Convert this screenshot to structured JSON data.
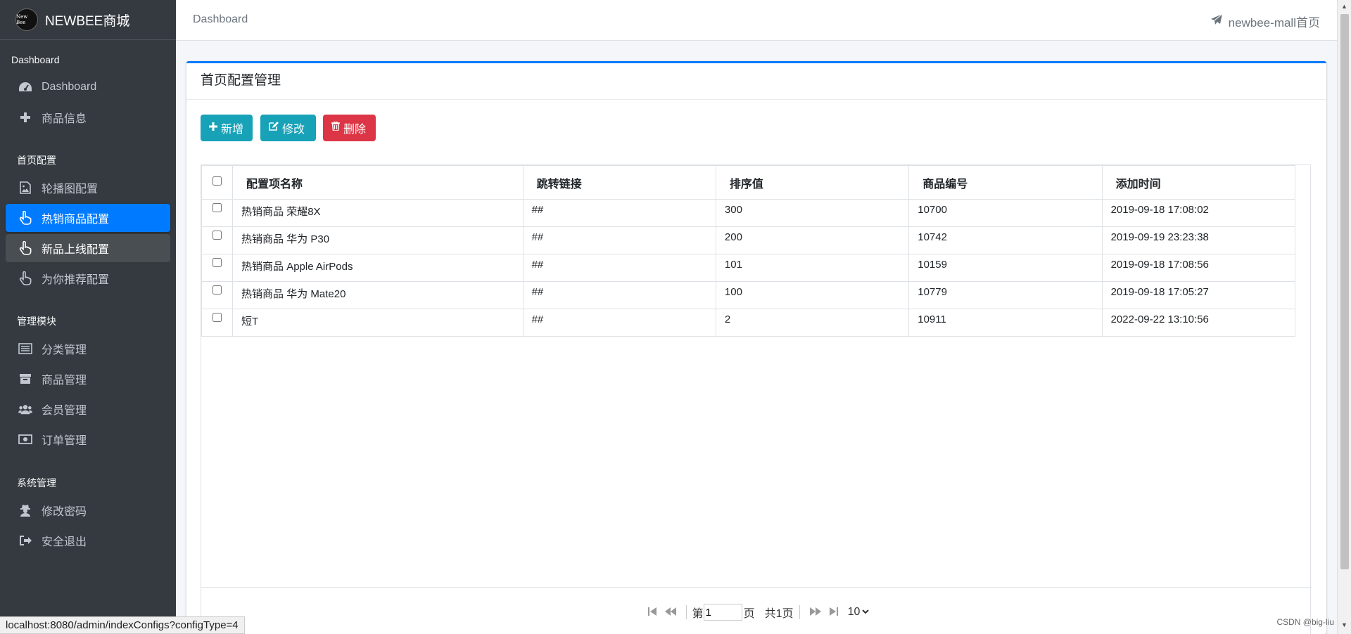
{
  "brand": {
    "logo_text": "New Bee",
    "name": "NEWBEE商城"
  },
  "sidebar": {
    "sections": [
      {
        "header": "Dashboard",
        "items": [
          "Dashboard",
          "商品信息"
        ]
      },
      {
        "header": "首页配置",
        "items": [
          "轮播图配置",
          "热销商品配置",
          "新品上线配置",
          "为你推荐配置"
        ]
      },
      {
        "header": "管理模块",
        "items": [
          "分类管理",
          "商品管理",
          "会员管理",
          "订单管理"
        ]
      },
      {
        "header": "系统管理",
        "items": [
          "修改密码",
          "安全退出"
        ]
      }
    ],
    "active_item": "热销商品配置"
  },
  "topbar": {
    "breadcrumb": "Dashboard",
    "home_link": "newbee-mall首页"
  },
  "card": {
    "title": "首页配置管理",
    "buttons": {
      "add": "新增",
      "edit": "修改",
      "delete": "删除"
    }
  },
  "table": {
    "headers": [
      "配置项名称",
      "跳转链接",
      "排序值",
      "商品编号",
      "添加时间"
    ],
    "rows": [
      [
        "热销商品 荣耀8X",
        "##",
        "300",
        "10700",
        "2019-09-18 17:08:02"
      ],
      [
        "热销商品 华为 P30",
        "##",
        "200",
        "10742",
        "2019-09-19 23:23:38"
      ],
      [
        "热销商品 Apple AirPods",
        "##",
        "101",
        "10159",
        "2019-09-18 17:08:56"
      ],
      [
        "热销商品 华为 Mate20",
        "##",
        "100",
        "10779",
        "2019-09-18 17:05:27"
      ],
      [
        "短T",
        "##",
        "2",
        "10911",
        "2022-09-22 13:10:56"
      ]
    ]
  },
  "pager": {
    "page_prefix": "第",
    "page_value": "1",
    "page_suffix": "页",
    "total": "共1页",
    "page_size": "10"
  },
  "statusbar": "localhost:8080/admin/indexConfigs?configType=4",
  "watermark": "CSDN @big-liu"
}
